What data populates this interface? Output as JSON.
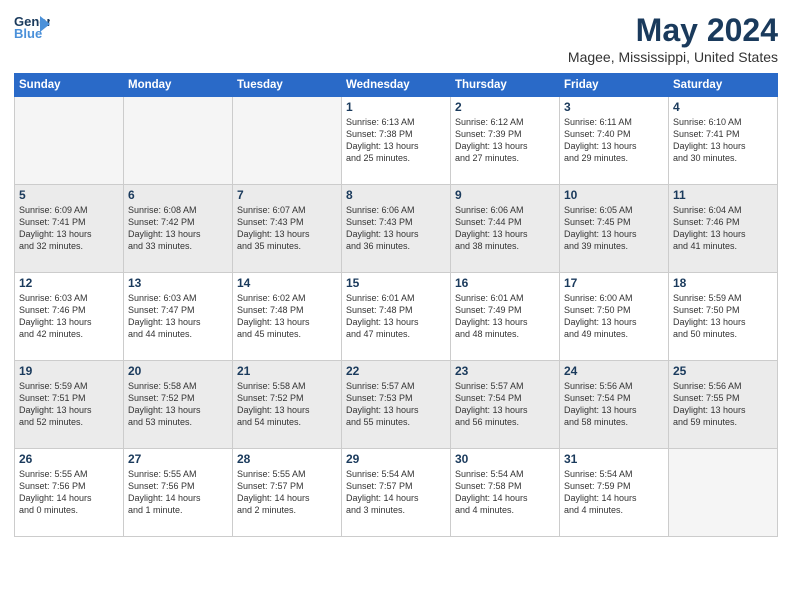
{
  "logo": {
    "line1": "General",
    "line2": "Blue"
  },
  "title": "May 2024",
  "location": "Magee, Mississippi, United States",
  "days_of_week": [
    "Sunday",
    "Monday",
    "Tuesday",
    "Wednesday",
    "Thursday",
    "Friday",
    "Saturday"
  ],
  "weeks": [
    [
      {
        "day": "",
        "info": "",
        "empty": true
      },
      {
        "day": "",
        "info": "",
        "empty": true
      },
      {
        "day": "",
        "info": "",
        "empty": true
      },
      {
        "day": "1",
        "info": "Sunrise: 6:13 AM\nSunset: 7:38 PM\nDaylight: 13 hours\nand 25 minutes."
      },
      {
        "day": "2",
        "info": "Sunrise: 6:12 AM\nSunset: 7:39 PM\nDaylight: 13 hours\nand 27 minutes."
      },
      {
        "day": "3",
        "info": "Sunrise: 6:11 AM\nSunset: 7:40 PM\nDaylight: 13 hours\nand 29 minutes."
      },
      {
        "day": "4",
        "info": "Sunrise: 6:10 AM\nSunset: 7:41 PM\nDaylight: 13 hours\nand 30 minutes."
      }
    ],
    [
      {
        "day": "5",
        "info": "Sunrise: 6:09 AM\nSunset: 7:41 PM\nDaylight: 13 hours\nand 32 minutes.",
        "shaded": true
      },
      {
        "day": "6",
        "info": "Sunrise: 6:08 AM\nSunset: 7:42 PM\nDaylight: 13 hours\nand 33 minutes.",
        "shaded": true
      },
      {
        "day": "7",
        "info": "Sunrise: 6:07 AM\nSunset: 7:43 PM\nDaylight: 13 hours\nand 35 minutes.",
        "shaded": true
      },
      {
        "day": "8",
        "info": "Sunrise: 6:06 AM\nSunset: 7:43 PM\nDaylight: 13 hours\nand 36 minutes.",
        "shaded": true
      },
      {
        "day": "9",
        "info": "Sunrise: 6:06 AM\nSunset: 7:44 PM\nDaylight: 13 hours\nand 38 minutes.",
        "shaded": true
      },
      {
        "day": "10",
        "info": "Sunrise: 6:05 AM\nSunset: 7:45 PM\nDaylight: 13 hours\nand 39 minutes.",
        "shaded": true
      },
      {
        "day": "11",
        "info": "Sunrise: 6:04 AM\nSunset: 7:46 PM\nDaylight: 13 hours\nand 41 minutes.",
        "shaded": true
      }
    ],
    [
      {
        "day": "12",
        "info": "Sunrise: 6:03 AM\nSunset: 7:46 PM\nDaylight: 13 hours\nand 42 minutes."
      },
      {
        "day": "13",
        "info": "Sunrise: 6:03 AM\nSunset: 7:47 PM\nDaylight: 13 hours\nand 44 minutes."
      },
      {
        "day": "14",
        "info": "Sunrise: 6:02 AM\nSunset: 7:48 PM\nDaylight: 13 hours\nand 45 minutes."
      },
      {
        "day": "15",
        "info": "Sunrise: 6:01 AM\nSunset: 7:48 PM\nDaylight: 13 hours\nand 47 minutes."
      },
      {
        "day": "16",
        "info": "Sunrise: 6:01 AM\nSunset: 7:49 PM\nDaylight: 13 hours\nand 48 minutes."
      },
      {
        "day": "17",
        "info": "Sunrise: 6:00 AM\nSunset: 7:50 PM\nDaylight: 13 hours\nand 49 minutes."
      },
      {
        "day": "18",
        "info": "Sunrise: 5:59 AM\nSunset: 7:50 PM\nDaylight: 13 hours\nand 50 minutes."
      }
    ],
    [
      {
        "day": "19",
        "info": "Sunrise: 5:59 AM\nSunset: 7:51 PM\nDaylight: 13 hours\nand 52 minutes.",
        "shaded": true
      },
      {
        "day": "20",
        "info": "Sunrise: 5:58 AM\nSunset: 7:52 PM\nDaylight: 13 hours\nand 53 minutes.",
        "shaded": true
      },
      {
        "day": "21",
        "info": "Sunrise: 5:58 AM\nSunset: 7:52 PM\nDaylight: 13 hours\nand 54 minutes.",
        "shaded": true
      },
      {
        "day": "22",
        "info": "Sunrise: 5:57 AM\nSunset: 7:53 PM\nDaylight: 13 hours\nand 55 minutes.",
        "shaded": true
      },
      {
        "day": "23",
        "info": "Sunrise: 5:57 AM\nSunset: 7:54 PM\nDaylight: 13 hours\nand 56 minutes.",
        "shaded": true
      },
      {
        "day": "24",
        "info": "Sunrise: 5:56 AM\nSunset: 7:54 PM\nDaylight: 13 hours\nand 58 minutes.",
        "shaded": true
      },
      {
        "day": "25",
        "info": "Sunrise: 5:56 AM\nSunset: 7:55 PM\nDaylight: 13 hours\nand 59 minutes.",
        "shaded": true
      }
    ],
    [
      {
        "day": "26",
        "info": "Sunrise: 5:55 AM\nSunset: 7:56 PM\nDaylight: 14 hours\nand 0 minutes."
      },
      {
        "day": "27",
        "info": "Sunrise: 5:55 AM\nSunset: 7:56 PM\nDaylight: 14 hours\nand 1 minute."
      },
      {
        "day": "28",
        "info": "Sunrise: 5:55 AM\nSunset: 7:57 PM\nDaylight: 14 hours\nand 2 minutes."
      },
      {
        "day": "29",
        "info": "Sunrise: 5:54 AM\nSunset: 7:57 PM\nDaylight: 14 hours\nand 3 minutes."
      },
      {
        "day": "30",
        "info": "Sunrise: 5:54 AM\nSunset: 7:58 PM\nDaylight: 14 hours\nand 4 minutes."
      },
      {
        "day": "31",
        "info": "Sunrise: 5:54 AM\nSunset: 7:59 PM\nDaylight: 14 hours\nand 4 minutes."
      },
      {
        "day": "",
        "info": "",
        "empty": true
      }
    ]
  ]
}
